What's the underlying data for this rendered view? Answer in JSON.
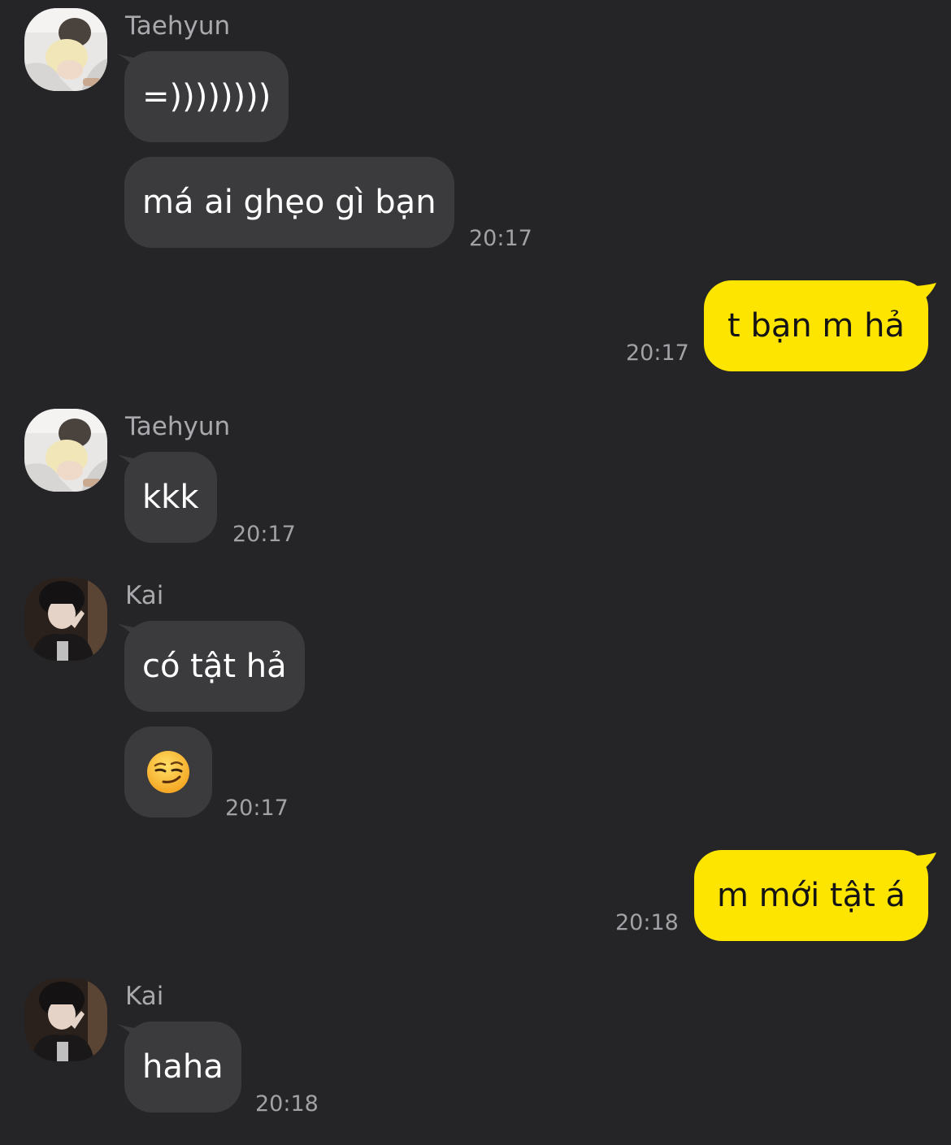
{
  "theme": {
    "background": "#252528",
    "incoming_bubble": "#3b3b3e",
    "outgoing_bubble": "#fde500",
    "name_color": "#a9a9ad",
    "time_color": "#a2a2a6"
  },
  "groups": [
    {
      "side": "incoming",
      "sender": "Taehyun",
      "avatar": "taehyun-avatar-photo",
      "messages": [
        {
          "text": "=))))))))"
        },
        {
          "text": "má ai ghẹo gì bạn",
          "time": "20:17"
        }
      ]
    },
    {
      "side": "outgoing",
      "messages": [
        {
          "text": "t bạn m hả",
          "time": "20:17"
        }
      ]
    },
    {
      "side": "incoming",
      "sender": "Taehyun",
      "avatar": "taehyun-avatar-photo",
      "messages": [
        {
          "text": "kkk",
          "time": "20:17"
        }
      ]
    },
    {
      "side": "incoming",
      "sender": "Kai",
      "avatar": "kai-avatar-photo",
      "messages": [
        {
          "text": "có tật hả"
        },
        {
          "emoji": "smirking-face",
          "time": "20:17"
        }
      ]
    },
    {
      "side": "outgoing",
      "messages": [
        {
          "text": "m mới tật á",
          "time": "20:18"
        }
      ]
    },
    {
      "side": "incoming",
      "sender": "Kai",
      "avatar": "kai-avatar-photo",
      "messages": [
        {
          "text": "haha",
          "time": "20:18"
        }
      ]
    }
  ]
}
